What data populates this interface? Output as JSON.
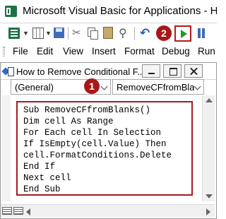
{
  "app": {
    "title": "Microsoft Visual Basic for Applications - How to Rem"
  },
  "menu": {
    "items": [
      "File",
      "Edit",
      "View",
      "Insert",
      "Format",
      "Debug",
      "Run"
    ]
  },
  "code_window": {
    "title": "How to Remove Conditional F...",
    "object_dropdown": "(General)",
    "procedure_dropdown": "RemoveCFfromBlan"
  },
  "code_lines": [
    "Sub RemoveCFfromBlanks()",
    "Dim cell As Range",
    "For Each cell In Selection",
    "If IsEmpty(cell.Value) Then",
    "cell.FormatConditions.Delete",
    "End If",
    "Next cell",
    "End Sub"
  ],
  "annotations": {
    "badge_1": "1",
    "badge_2": "2"
  },
  "colors": {
    "highlight_red": "#a81818",
    "run_green": "#1a9a2a",
    "excel_green": "#1e7145"
  }
}
